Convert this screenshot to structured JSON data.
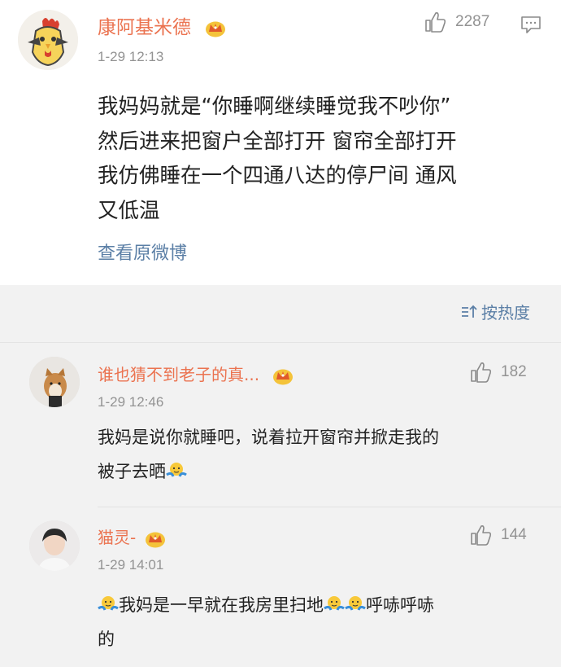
{
  "main_post": {
    "username": "康阿基米德",
    "time": "1-29 12:13",
    "like_count": "2287",
    "text_lines": [
      "我妈妈就是“你睡啊继续睡觉我不吵你”",
      "然后进来把窗户全部打开 窗帘全部打开",
      "我仿佛睡在一个四通八达的停尸间 通风",
      "又低温"
    ],
    "view_origin": "查看原微博"
  },
  "sort": {
    "label": "按热度"
  },
  "comments": [
    {
      "username": "谁也猜不到老子的真...",
      "time": "1-29 12:46",
      "like_count": "182",
      "line1": "我妈是说你就睡吧，说着拉开窗帘并掀走我的",
      "line2": "被子去晒"
    },
    {
      "username": "猫灵-",
      "time": "1-29 14:01",
      "like_count": "144",
      "line1_a": "我妈是一早就在我房里扫地",
      "line1_b": "呼哧呼哧",
      "line2": "的"
    }
  ],
  "colors": {
    "username": "#eb7350",
    "link": "#5b7fa6",
    "meta": "#939393"
  }
}
